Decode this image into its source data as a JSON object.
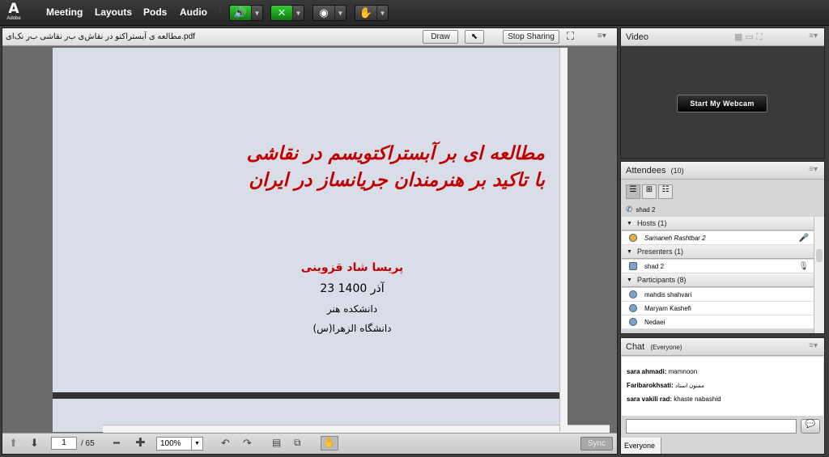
{
  "topbar": {
    "logo": "A",
    "logo_text": "Adobe",
    "menus": [
      "Meeting",
      "Layouts",
      "Pods",
      "Audio"
    ]
  },
  "share_pod": {
    "filename": "مطالعه ی آبستراکتو در نقاش‌ی ب‌ر نقاشی ب‌ر نک‌ای.pdf",
    "draw_label": "Draw",
    "stop_sharing_label": "Stop Sharing",
    "slide": {
      "title_line1": "مطالعه ای بر آبستراکتویسم در نقاشی",
      "title_line2": "با تاکید بر هنرمندان جریانساز در ایران",
      "author": "پریسا شاد قزوینی",
      "date": "23 آذر 1400",
      "faculty": "دانشکده هنر",
      "university": "دانشگاه الزهرا(س)"
    },
    "page_current": "1",
    "page_total": "/ 65",
    "zoom": "100%",
    "sync_label": "Sync"
  },
  "video_pod": {
    "title": "Video",
    "webcam_label": "Start My Webcam"
  },
  "attendees_pod": {
    "title": "Attendees",
    "count": "(10)",
    "current_user": "shad 2",
    "hosts_header": "Hosts (1)",
    "hosts": [
      "Samaneh Rashtbar 2"
    ],
    "presenters_header": "Presenters (1)",
    "presenters": [
      "shad 2"
    ],
    "participants_header": "Participants (8)",
    "participants": [
      "mahdis shahvari",
      "Maryam Kashefi",
      "Nedaei"
    ]
  },
  "chat_pod": {
    "title": "Chat",
    "scope": "(Everyone)",
    "messages": [
      {
        "author": "sara ahmadi:",
        "text": "mamnoon"
      },
      {
        "author": "Faribarokhsati:",
        "text": "ممنون استاد"
      },
      {
        "author": "sara vakili rad:",
        "text": "khaste nabashid"
      }
    ],
    "tab_label": "Everyone"
  },
  "colors": {
    "title_red": "#c00000",
    "chrome_dark": "#262626",
    "pod_bg": "#d6d6d6"
  }
}
